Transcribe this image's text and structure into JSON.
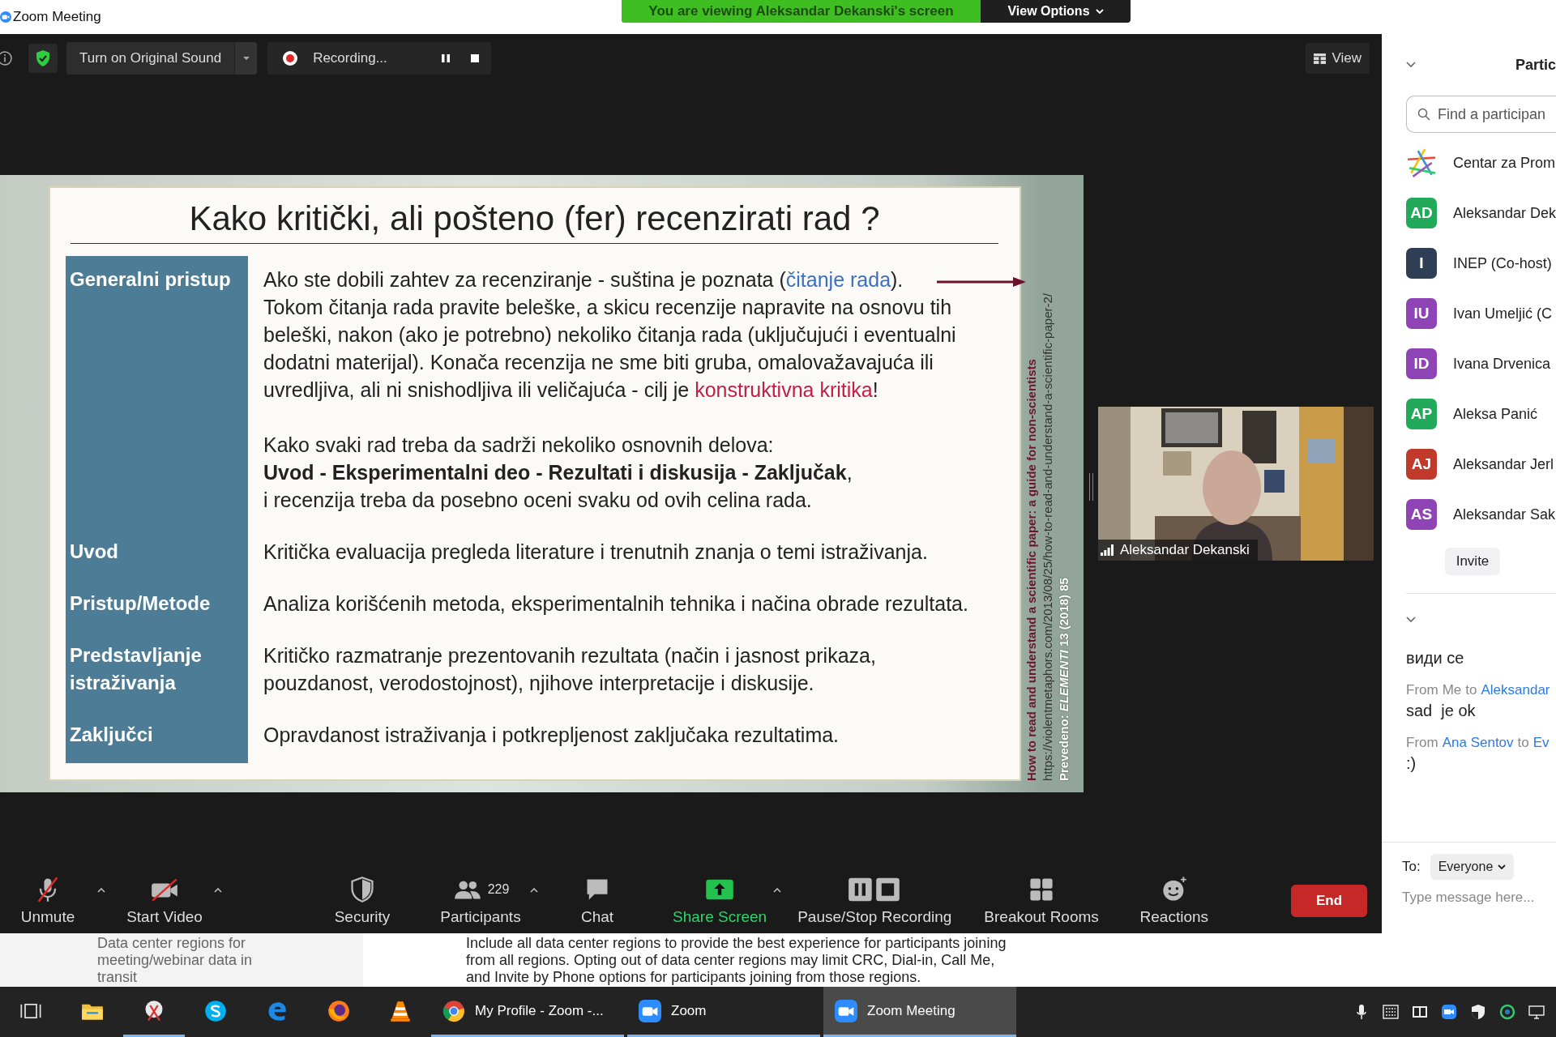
{
  "window": {
    "title": "Zoom Meeting"
  },
  "share_banner": {
    "message": "You are viewing Aleksandar Dekanski's screen",
    "options_button": "View Options"
  },
  "meeting_toolbar": {
    "original_sound_button": "Turn on Original Sound",
    "recording_label": "Recording...",
    "view_button": "View"
  },
  "slide": {
    "title": "Kako kritički, ali pošteno (fer) recenzirati rad ?",
    "rows": [
      {
        "label": "Generalni pristup",
        "blocks": [
          [
            [
              {
                "text": "Ako ste dobili zahtev za recenziranje - suština je poznata (",
                "kind": "plain"
              },
              {
                "text": "čitanje rada",
                "kind": "link"
              },
              {
                "text": ").",
                "kind": "plain"
              }
            ],
            [
              {
                "text": "Tokom čitanja rada pravite beleške, a skicu recenzije napravite na osnovu tih",
                "kind": "plain"
              }
            ],
            [
              {
                "text": "beleški, nakon (ako je potrebno) nekoliko čitanja rada (uključujući i eventualni",
                "kind": "plain"
              }
            ],
            [
              {
                "text": "dodatni materijal). Konača recenzija ne sme biti gruba, omalovažavajuća ili",
                "kind": "plain"
              }
            ],
            [
              {
                "text": "uvredljiva, ali ni snishodljiva ili veličajuća - cilj je ",
                "kind": "plain"
              },
              {
                "text": "konstruktivna kritika",
                "kind": "highlight"
              },
              {
                "text": "!",
                "kind": "plain"
              }
            ]
          ],
          [
            [
              {
                "text": "Kako svaki rad treba da sadrži nekoliko osnovnih delova:",
                "kind": "plain"
              }
            ],
            [
              {
                "text": "Uvod - Eksperimentalni deo - Rezultati i diskusija - Zaključak",
                "kind": "emphasis"
              },
              {
                "text": ",",
                "kind": "plain"
              }
            ],
            [
              {
                "text": "i recenzija treba da posebno oceni svaku od ovih celina rada.",
                "kind": "plain"
              }
            ]
          ]
        ]
      },
      {
        "label": "Uvod",
        "blocks": [
          [
            [
              {
                "text": "Kritička evaluacija pregleda literature i trenutnih znanja o temi istraživanja.",
                "kind": "plain"
              }
            ]
          ]
        ]
      },
      {
        "label": "Pristup/Metode",
        "blocks": [
          [
            [
              {
                "text": "Analiza korišćenih metoda, eksperimentalnih tehnika i načina obrade rezultata.",
                "kind": "plain"
              }
            ]
          ]
        ]
      },
      {
        "label": "Predstavljanje istraživanja",
        "blocks": [
          [
            [
              {
                "text": "Kritičko razmatranje prezentovanih rezultata (način i jasnost prikaza,",
                "kind": "plain"
              }
            ],
            [
              {
                "text": "pouzdanost, verodostojnost), njihove interpretacije i diskusije.",
                "kind": "plain"
              }
            ]
          ]
        ]
      },
      {
        "label": "Zaključci",
        "blocks": [
          [
            [
              {
                "text": "Opravdanost istraživanja i potkrepljenost zaključaka rezultatima.",
                "kind": "plain"
              }
            ]
          ]
        ]
      }
    ],
    "source_title": "How to read and understand a scientific paper: a guide for non-scientists",
    "source_url": "https://violentmetaphors.com/2013/08/25/how-to-read-and-understand-a-scientific-paper-2/",
    "translation_note": "Prevedeno: *ELEMENTI* 13 (2018) 85"
  },
  "video_tile": {
    "name": "Aleksandar Dekanski"
  },
  "bottom_toolbar": {
    "buttons": [
      {
        "kind": "mic",
        "label": "Unmute",
        "off": true,
        "menu": true
      },
      {
        "kind": "video",
        "label": "Start Video",
        "off": true,
        "menu": true
      },
      {
        "kind": "security",
        "label": "Security",
        "menu": false
      },
      {
        "kind": "participants",
        "label": "Participants",
        "count": "229",
        "menu": true
      },
      {
        "kind": "chat",
        "label": "Chat",
        "menu": false
      },
      {
        "kind": "share",
        "label": "Share Screen",
        "menu": true
      },
      {
        "kind": "record",
        "label": "Pause/Stop Recording",
        "menu": false
      },
      {
        "kind": "breakout",
        "label": "Breakout Rooms",
        "menu": false
      },
      {
        "kind": "reactions",
        "label": "Reactions",
        "menu": false
      }
    ],
    "end_button": "End"
  },
  "participants_panel": {
    "title": "Partic",
    "search": {
      "placeholder": "Find a participan"
    },
    "participants": [
      {
        "kind": "logo",
        "name": "Centar za Prom"
      },
      {
        "kind": "avatar",
        "initials": "AD",
        "name": "Aleksandar Dek",
        "color": "#23a95a"
      },
      {
        "kind": "avatar",
        "initials": "I",
        "name": "INEP (Co-host)",
        "color": "#2e3e55"
      },
      {
        "kind": "avatar",
        "initials": "IU",
        "name": "Ivan Umeljić (C",
        "color": "#8e44b5"
      },
      {
        "kind": "avatar",
        "initials": "ID",
        "name": "Ivana Drvenica",
        "color": "#8e44b5"
      },
      {
        "kind": "avatar",
        "initials": "AP",
        "name": "Aleksa Panić",
        "color": "#23a95a"
      },
      {
        "kind": "avatar",
        "initials": "AJ",
        "name": "Aleksandar Jerl",
        "color": "#c0392b"
      },
      {
        "kind": "avatar",
        "initials": "AS",
        "name": "Aleksandar Sak",
        "color": "#8e44b5"
      }
    ],
    "invite_button": "Invite"
  },
  "chat": {
    "messages": [
      {
        "text": "види се"
      },
      {
        "from_word": "From",
        "sender": "Me",
        "sender_link": false,
        "to_word": "to",
        "recipient": "Aleksandar",
        "text": "sad  je ok"
      },
      {
        "from_word": "From",
        "sender": "Ana Sentov",
        "sender_link": true,
        "to_word": "to",
        "recipient": "Ev",
        "text": ":)"
      }
    ],
    "to_label": "To:",
    "recipient_select": "Everyone",
    "input": {
      "placeholder": "Type message here..."
    }
  },
  "background_page": {
    "left_lines": [
      "Data center regions for",
      "meeting/webinar data in",
      "transit"
    ],
    "right_lines": [
      "Include all data center regions to provide the best experience for participants joining",
      "from all regions. Opting out of data center regions may limit CRC, Dial-in, Call Me,",
      "and Invite by Phone options for participants joining from those regions."
    ]
  },
  "taskbar": {
    "apps": [
      {
        "kind": "task-view",
        "open": false,
        "active": false
      },
      {
        "kind": "folder",
        "open": false,
        "active": false
      },
      {
        "kind": "snip",
        "open": true,
        "active": false
      },
      {
        "kind": "skype",
        "open": false,
        "active": false
      },
      {
        "kind": "edge",
        "open": false,
        "active": false
      },
      {
        "kind": "firefox",
        "open": false,
        "active": false
      },
      {
        "kind": "vlc",
        "open": false,
        "active": false
      },
      {
        "kind": "chrome",
        "label": "My Profile - Zoom -...",
        "open": true,
        "active": false
      },
      {
        "kind": "zoom",
        "label": "Zoom",
        "open": true,
        "active": false
      },
      {
        "kind": "zoom",
        "label": "Zoom Meeting",
        "open": true,
        "active": true
      }
    ]
  }
}
